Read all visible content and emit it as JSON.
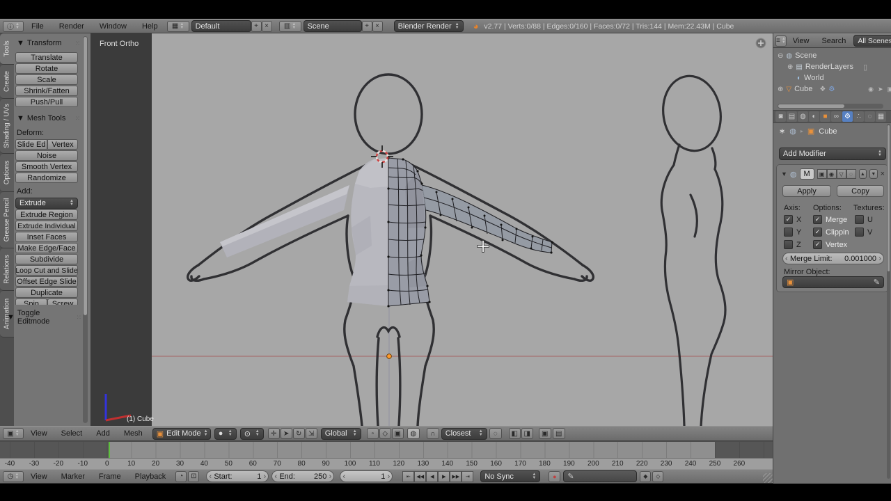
{
  "topbar": {
    "editor_icon": "ⓘ",
    "menus": [
      "File",
      "Render",
      "Window",
      "Help"
    ],
    "layout_icon": "▦",
    "layout_value": "Default",
    "scene_icon": "▥",
    "scene_value": "Scene",
    "add_icon": "+",
    "close_icon": "×",
    "engine": "Blender Render",
    "logo_icon": "◕",
    "stats": "v2.77 | Verts:0/88 | Edges:0/160 | Faces:0/72 | Tris:144 | Mem:22.43M | Cube"
  },
  "tool_shelf": {
    "tabs": [
      {
        "label": "Tools",
        "active": true
      },
      {
        "label": "Create"
      },
      {
        "label": "Shading / UVs"
      },
      {
        "label": "Options"
      },
      {
        "label": "Grease Pencil"
      },
      {
        "label": "Relations"
      },
      {
        "label": "Animation"
      }
    ],
    "transform_title": "Transform",
    "transform_buttons": [
      "Translate",
      "Rotate",
      "Scale",
      "Shrink/Fatten",
      "Push/Pull"
    ],
    "mesh_tools_title": "Mesh Tools",
    "deform_label": "Deform:",
    "slide_ed": "Slide Ed",
    "vertex": "Vertex",
    "deform_buttons": [
      "Noise",
      "Smooth Vertex",
      "Randomize"
    ],
    "add_label": "Add:",
    "extrude": "Extrude",
    "add_buttons": [
      "Extrude Region",
      "Extrude Individual",
      "Inset Faces",
      "Make Edge/Face",
      "Subdivide",
      "Loop Cut and Slide",
      "Offset Edge Slide",
      "Duplicate"
    ],
    "spin": "Spin",
    "screw": "Screw",
    "toggle_editmode": "Toggle Editmode"
  },
  "viewport": {
    "view_label": "Front Ortho",
    "object_label": "(1) Cube"
  },
  "vp_header": {
    "editor_icon": "▣",
    "menus": [
      "View",
      "Select",
      "Add",
      "Mesh"
    ],
    "mode_icon": "▣",
    "mode_label": "Edit Mode",
    "shading_icon": "●",
    "pivot_icon": "⊙",
    "manip_icons": [
      {
        "g": "✛"
      },
      {
        "g": "➤",
        "active": true
      },
      {
        "g": "↻"
      },
      {
        "g": "⇲"
      }
    ],
    "orientation": "Global",
    "select_icons": [
      {
        "g": "▫",
        "active": true
      },
      {
        "g": "◇"
      },
      {
        "g": "▣"
      }
    ],
    "occlude_icon": "◍",
    "magnet_icon": "∩",
    "snap_mode": "Closest",
    "snap_target_icon": "◌",
    "pair_icons": [
      "◧",
      "◨"
    ],
    "render_icon": "▣",
    "clapper_icon": "▤"
  },
  "outliner": {
    "editor_icon": "≡",
    "menus": [
      "View",
      "Search"
    ],
    "filter": "All Scenes",
    "scene_exp": "⊖",
    "scene_icon": "◍",
    "scene_label": "Scene",
    "rl_exp": "⊕",
    "rl_icon": "▤",
    "rl_label": "RenderLayers",
    "rl_badge": "▯",
    "world_icon": "◐",
    "world_label": "World",
    "cube_exp": "⊕",
    "cube_icon": "▽",
    "cube_label": "Cube",
    "cube_data_icon": "❖",
    "cube_wrench_icon": "⚙",
    "restrict_icons": [
      "◉",
      "➤",
      "▣"
    ]
  },
  "properties": {
    "tabs": [
      {
        "g": "◙"
      },
      {
        "g": "▤"
      },
      {
        "g": "◍"
      },
      {
        "g": "◐"
      },
      {
        "g": "■"
      },
      {
        "g": "∞"
      },
      {
        "g": "⚙",
        "active": true
      },
      {
        "g": "∴"
      },
      {
        "g": "◌"
      },
      {
        "g": "▦"
      }
    ],
    "pin_icon": "∗",
    "chain_icon": "◍",
    "sep_icon": "▸",
    "object_icon": "▣",
    "object_name": "Cube",
    "add_modifier": "Add Modifier",
    "mod_expand": "▼",
    "mod_icon": "◍",
    "mod_name": "M",
    "mod_toggles": [
      "▣",
      "◉",
      "▽",
      "◌"
    ],
    "mod_close": "×",
    "apply": "Apply",
    "copy": "Copy",
    "axis_label": "Axis:",
    "options_label": "Options:",
    "textures_label": "Textures:",
    "cb_x": "X",
    "cb_y": "Y",
    "cb_z": "Z",
    "cb_merge": "Merge",
    "cb_clipping": "Clippin",
    "cb_vertex": "Vertex",
    "cb_u": "U",
    "cb_v": "V",
    "checks_on": [
      "X",
      "Merge",
      "Clippin",
      "Vertex"
    ],
    "merge_limit_label": "Merge Limit:",
    "merge_limit_value": "0.001000",
    "mirror_object_label": "Mirror Object:",
    "mirror_icon": "▣",
    "eyedropper_icon": "✎"
  },
  "timeline": {
    "editor_icon": "◷",
    "menus": [
      "View",
      "Marker",
      "Frame",
      "Playback"
    ],
    "tool_icons": [
      "◔",
      "⊡"
    ],
    "start_label": "Start:",
    "start_value": "1",
    "end_label": "End:",
    "end_value": "250",
    "frame_value": "1",
    "playback": [
      "⇤",
      "◀◀",
      "◀",
      "▶",
      "▶▶",
      "⇥"
    ],
    "sync": "No Sync",
    "record_icon": "●",
    "key_icon": "✎",
    "key_buttons": [
      "◆",
      "◇"
    ],
    "ticks": [
      -40,
      -30,
      -20,
      -10,
      0,
      10,
      20,
      30,
      40,
      50,
      60,
      70,
      80,
      90,
      100,
      110,
      120,
      130,
      140,
      150,
      160,
      170,
      180,
      190,
      200,
      210,
      220,
      230,
      240,
      250,
      260
    ],
    "accent_playhead": "#5fbf3f",
    "accent_record": "#c23f3f"
  }
}
